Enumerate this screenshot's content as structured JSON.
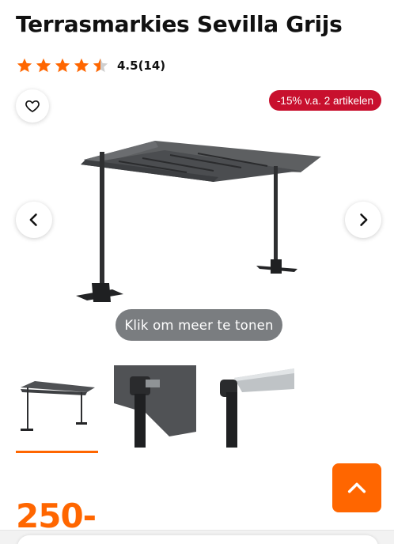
{
  "product": {
    "title": "Terrasmarkies Sevilla Grijs",
    "rating_text": "4.5(14)",
    "rating_value": 4.5,
    "price": "250-"
  },
  "promo": {
    "label": "-15% v.a. 2 artikelen"
  },
  "gallery": {
    "more_label": "Klik om meer te tonen",
    "active_thumbnail": 1,
    "thumbnail_count": 3
  },
  "icons": {
    "favorite": "heart-icon",
    "prev": "chevron-left-icon",
    "next": "chevron-right-icon",
    "scroll_top": "chevron-up-icon",
    "star": "star-icon"
  },
  "colors": {
    "accent": "#ff6600",
    "promo_badge": "#c8102e",
    "more_button": "#7a7d80",
    "star": "#ff6600"
  }
}
